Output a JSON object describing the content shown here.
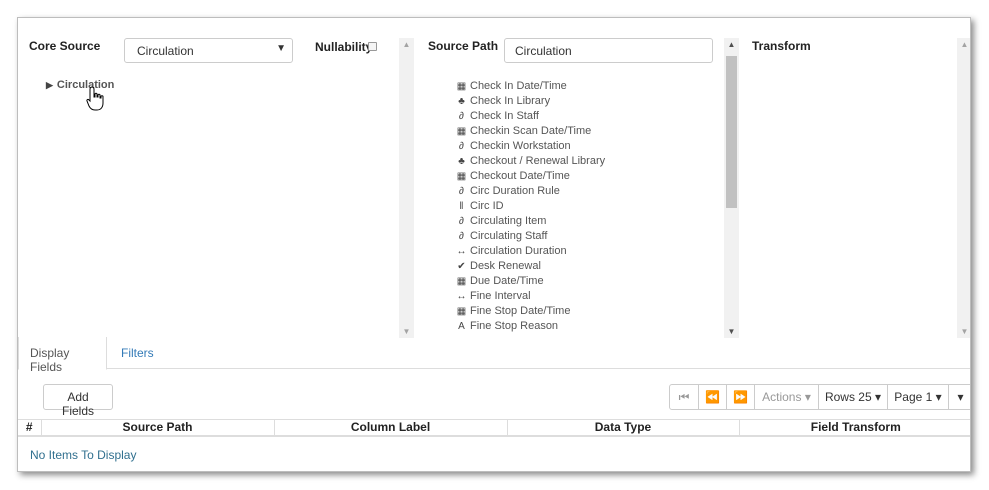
{
  "core_source": {
    "header": "Core Source",
    "selected": "Circulation",
    "tree_root": "Circulation"
  },
  "nullability": {
    "label": "Nullability",
    "checked": false
  },
  "source_path": {
    "header": "Source Path",
    "input_value": "Circulation",
    "fields": [
      {
        "icon": "calendar-icon",
        "glyph": "▦",
        "label": "Check In Date/Time"
      },
      {
        "icon": "tree-icon",
        "glyph": "♣",
        "label": "Check In Library"
      },
      {
        "icon": "link-icon",
        "glyph": "∂",
        "label": "Check In Staff"
      },
      {
        "icon": "calendar-icon",
        "glyph": "▦",
        "label": "Checkin Scan Date/Time"
      },
      {
        "icon": "link-icon",
        "glyph": "∂",
        "label": "Checkin Workstation"
      },
      {
        "icon": "tree-icon",
        "glyph": "♣",
        "label": "Checkout / Renewal Library"
      },
      {
        "icon": "calendar-icon",
        "glyph": "▦",
        "label": "Checkout Date/Time"
      },
      {
        "icon": "link-icon",
        "glyph": "∂",
        "label": "Circ Duration Rule"
      },
      {
        "icon": "barcode-icon",
        "glyph": "‖",
        "label": "Circ ID"
      },
      {
        "icon": "link-icon",
        "glyph": "∂",
        "label": "Circulating Item"
      },
      {
        "icon": "link-icon",
        "glyph": "∂",
        "label": "Circulating Staff"
      },
      {
        "icon": "interval-icon",
        "glyph": "↔",
        "label": "Circulation Duration"
      },
      {
        "icon": "check-circle-icon",
        "glyph": "✔",
        "label": "Desk Renewal"
      },
      {
        "icon": "calendar-icon",
        "glyph": "▦",
        "label": "Due Date/Time"
      },
      {
        "icon": "interval-icon",
        "glyph": "↔",
        "label": "Fine Interval"
      },
      {
        "icon": "calendar-icon",
        "glyph": "▦",
        "label": "Fine Stop Date/Time"
      },
      {
        "icon": "text-icon",
        "glyph": "A",
        "label": "Fine Stop Reason"
      }
    ]
  },
  "transform": {
    "header": "Transform"
  },
  "tabs": [
    {
      "label": "Display Fields",
      "active": true
    },
    {
      "label": "Filters",
      "active": false
    }
  ],
  "toolbar": {
    "add_fields": "Add Fields",
    "first_icon": "⏮",
    "prev_icon": "⏪",
    "next_icon": "⏩",
    "actions": "Actions",
    "rows": "Rows 25",
    "page": "Page 1"
  },
  "grid": {
    "columns": [
      "#",
      "Source Path",
      "Column Label",
      "Data Type",
      "Field Transform"
    ],
    "empty_message": "No Items To Display"
  }
}
